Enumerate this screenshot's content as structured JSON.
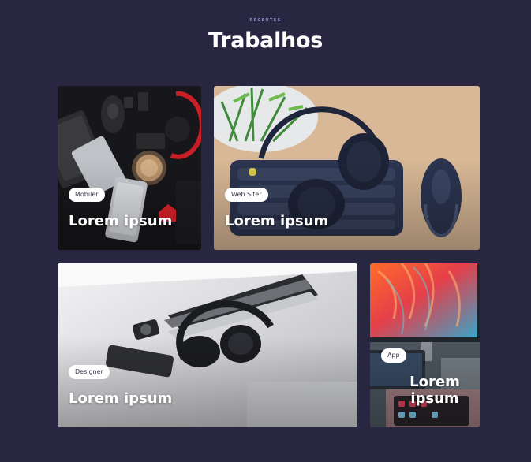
{
  "section": {
    "eyebrow": "RECENTES",
    "title": "Trabalhos"
  },
  "cards": [
    {
      "tag": "Mobiler",
      "title": "Lorem ipsum",
      "image": "desk-accessories-photo"
    },
    {
      "tag": "Web Siter",
      "title": "Lorem ipsum",
      "image": "headphones-keyboard-photo"
    },
    {
      "tag": "Designer",
      "title": "Lorem ipsum",
      "image": "laptop-headphones-photo"
    },
    {
      "tag": "App",
      "title": "Lorem ipsum",
      "image": "monitor-tablet-photo"
    }
  ],
  "colors": {
    "background": "#282641",
    "eyebrow": "#8d86c9",
    "title": "#ffffff",
    "tag_bg": "#ffffff",
    "tag_text": "#3a3a4d"
  }
}
